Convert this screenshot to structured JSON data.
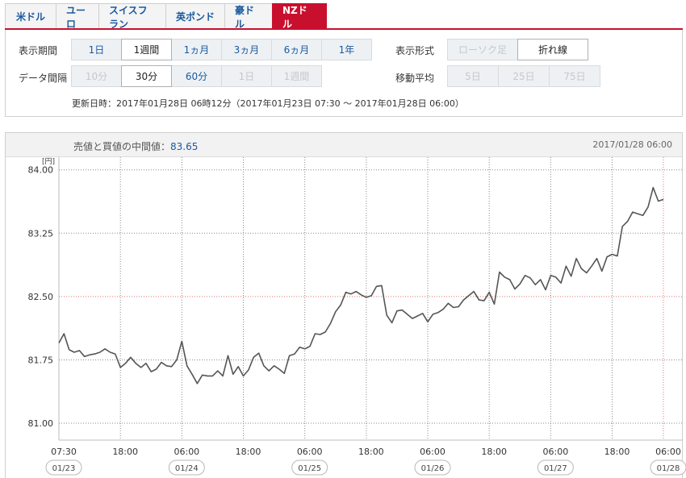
{
  "tabs": [
    {
      "label": "米ドル",
      "active": false
    },
    {
      "label": "ユーロ",
      "active": false
    },
    {
      "label": "スイスフラン",
      "active": false
    },
    {
      "label": "英ポンド",
      "active": false
    },
    {
      "label": "豪ドル",
      "active": false
    },
    {
      "label": "NZドル",
      "active": true
    }
  ],
  "settings": {
    "period_label": "表示期間",
    "period_options": [
      {
        "label": "1日",
        "state": "normal"
      },
      {
        "label": "1週間",
        "state": "selected"
      },
      {
        "label": "1ヵ月",
        "state": "normal"
      },
      {
        "label": "3ヵ月",
        "state": "normal"
      },
      {
        "label": "6ヵ月",
        "state": "normal"
      },
      {
        "label": "1年",
        "state": "normal"
      }
    ],
    "interval_label": "データ間隔",
    "interval_options": [
      {
        "label": "10分",
        "state": "disabled"
      },
      {
        "label": "30分",
        "state": "selected"
      },
      {
        "label": "60分",
        "state": "normal"
      },
      {
        "label": "1日",
        "state": "disabled"
      },
      {
        "label": "1週間",
        "state": "disabled"
      }
    ],
    "format_label": "表示形式",
    "format_options": [
      {
        "label": "ローソク足",
        "state": "disabled"
      },
      {
        "label": "折れ線",
        "state": "selected"
      }
    ],
    "ma_label": "移動平均",
    "ma_options": [
      {
        "label": "5日",
        "state": "disabled"
      },
      {
        "label": "25日",
        "state": "disabled"
      },
      {
        "label": "75日",
        "state": "disabled"
      }
    ],
    "updated_text": "更新日時：2017年01月28日 06時12分（2017年01月23日 07:30 ～ 2017年01月28日 06:00）"
  },
  "chart_header": {
    "mid_label": "売値と買値の中間値：",
    "mid_value": "83.65",
    "timestamp": "2017/01/28 06:00"
  },
  "chart_data": {
    "type": "line",
    "yunit": "[円]",
    "ylim": [
      80.8,
      84.15
    ],
    "yticks": [
      84.0,
      83.25,
      82.5,
      81.75,
      81.0
    ],
    "ytick_labels": [
      "84.00",
      "83.25",
      "82.50",
      "81.75",
      "81.00"
    ],
    "xlim": [
      0,
      118
    ],
    "x_ticks": [
      {
        "x": 0,
        "label": "07:30",
        "date": "01/23"
      },
      {
        "x": 12,
        "label": "18:00",
        "date": ""
      },
      {
        "x": 24,
        "label": "06:00",
        "date": "01/24"
      },
      {
        "x": 36,
        "label": "18:00",
        "date": ""
      },
      {
        "x": 48,
        "label": "06:00",
        "date": "01/25"
      },
      {
        "x": 60,
        "label": "18:00",
        "date": ""
      },
      {
        "x": 72,
        "label": "06:00",
        "date": "01/26"
      },
      {
        "x": 84,
        "label": "18:00",
        "date": ""
      },
      {
        "x": 96,
        "label": "06:00",
        "date": "01/27"
      },
      {
        "x": 108,
        "label": "18:00",
        "date": ""
      },
      {
        "x": 118,
        "label": "06:00",
        "date": "01/28"
      }
    ],
    "reference_y": 82.5,
    "current_x": 118,
    "grid": true,
    "series": [
      {
        "values": [
          81.95,
          82.06,
          81.87,
          81.84,
          81.86,
          81.79,
          81.81,
          81.82,
          81.84,
          81.88,
          81.84,
          81.82,
          81.66,
          81.71,
          81.78,
          81.71,
          81.66,
          81.71,
          81.61,
          81.64,
          81.72,
          81.68,
          81.67,
          81.75,
          81.97,
          81.68,
          81.58,
          81.47,
          81.57,
          81.56,
          81.56,
          81.62,
          81.56,
          81.8,
          81.58,
          81.67,
          81.56,
          81.63,
          81.78,
          81.83,
          81.68,
          81.62,
          81.68,
          81.64,
          81.59,
          81.8,
          81.82,
          81.9,
          81.88,
          81.91,
          82.06,
          82.05,
          82.08,
          82.18,
          82.32,
          82.4,
          82.55,
          82.53,
          82.56,
          82.52,
          82.49,
          82.51,
          82.62,
          82.63,
          82.28,
          82.19,
          82.33,
          82.34,
          82.29,
          82.24,
          82.27,
          82.3,
          82.2,
          82.29,
          82.31,
          82.35,
          82.42,
          82.37,
          82.38,
          82.46,
          82.51,
          82.56,
          82.46,
          82.45,
          82.55,
          82.41,
          82.79,
          82.73,
          82.7,
          82.59,
          82.65,
          82.75,
          82.72,
          82.64,
          82.7,
          82.58,
          82.75,
          82.73,
          82.66,
          82.86,
          82.74,
          82.95,
          82.83,
          82.78,
          82.86,
          82.95,
          82.8,
          82.97,
          83.0,
          82.98,
          83.33,
          83.39,
          83.5,
          83.48,
          83.46,
          83.56,
          83.79,
          83.63,
          83.65
        ],
        "color": "#555555"
      }
    ]
  }
}
